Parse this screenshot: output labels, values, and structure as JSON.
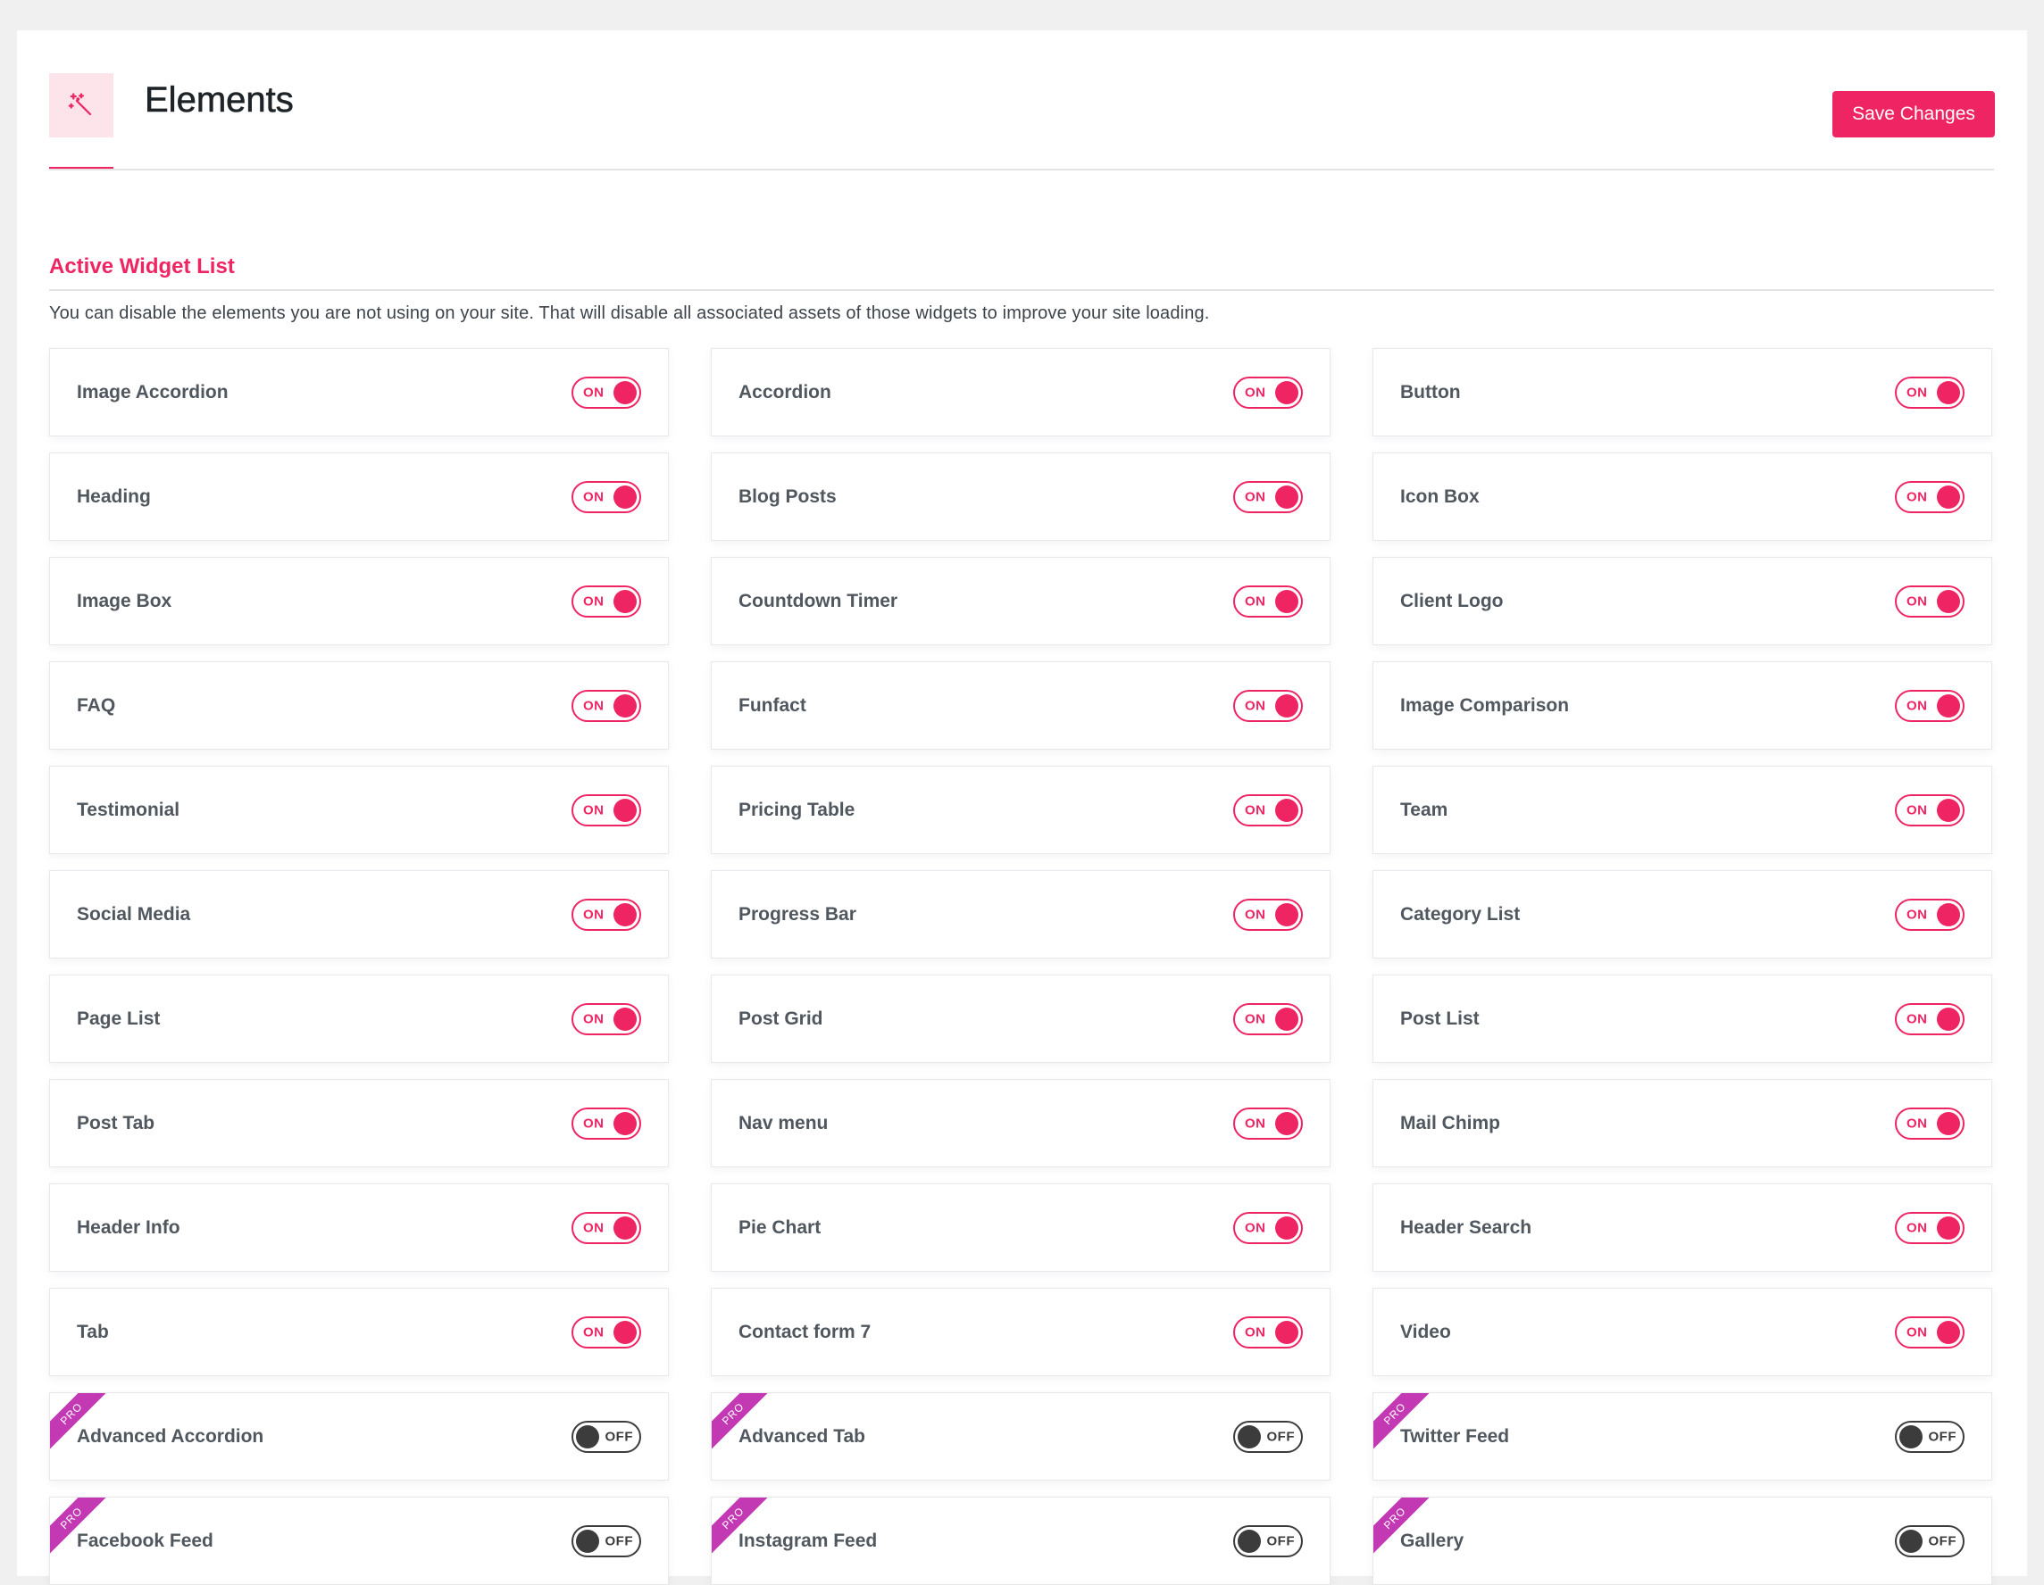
{
  "header": {
    "title": "Elements",
    "save_label": "Save Changes",
    "icon": "magic-wand-icon"
  },
  "section": {
    "title": "Active Widget List",
    "description": "You can disable the elements you are not using on your site. That will disable all associated assets of those widgets to improve your site loading."
  },
  "colors": {
    "accent": "#ef2563",
    "pro_ribbon": "#c239b3",
    "off": "#3c3c3c"
  },
  "widgets": [
    {
      "name": "Image Accordion",
      "state": "ON",
      "pro": false
    },
    {
      "name": "Accordion",
      "state": "ON",
      "pro": false
    },
    {
      "name": "Button",
      "state": "ON",
      "pro": false
    },
    {
      "name": "Heading",
      "state": "ON",
      "pro": false
    },
    {
      "name": "Blog Posts",
      "state": "ON",
      "pro": false
    },
    {
      "name": "Icon Box",
      "state": "ON",
      "pro": false
    },
    {
      "name": "Image Box",
      "state": "ON",
      "pro": false
    },
    {
      "name": "Countdown Timer",
      "state": "ON",
      "pro": false
    },
    {
      "name": "Client Logo",
      "state": "ON",
      "pro": false
    },
    {
      "name": "FAQ",
      "state": "ON",
      "pro": false
    },
    {
      "name": "Funfact",
      "state": "ON",
      "pro": false
    },
    {
      "name": "Image Comparison",
      "state": "ON",
      "pro": false
    },
    {
      "name": "Testimonial",
      "state": "ON",
      "pro": false
    },
    {
      "name": "Pricing Table",
      "state": "ON",
      "pro": false
    },
    {
      "name": "Team",
      "state": "ON",
      "pro": false
    },
    {
      "name": "Social Media",
      "state": "ON",
      "pro": false
    },
    {
      "name": "Progress Bar",
      "state": "ON",
      "pro": false
    },
    {
      "name": "Category List",
      "state": "ON",
      "pro": false
    },
    {
      "name": "Page List",
      "state": "ON",
      "pro": false
    },
    {
      "name": "Post Grid",
      "state": "ON",
      "pro": false
    },
    {
      "name": "Post List",
      "state": "ON",
      "pro": false
    },
    {
      "name": "Post Tab",
      "state": "ON",
      "pro": false
    },
    {
      "name": "Nav menu",
      "state": "ON",
      "pro": false
    },
    {
      "name": "Mail Chimp",
      "state": "ON",
      "pro": false
    },
    {
      "name": "Header Info",
      "state": "ON",
      "pro": false
    },
    {
      "name": "Pie Chart",
      "state": "ON",
      "pro": false
    },
    {
      "name": "Header Search",
      "state": "ON",
      "pro": false
    },
    {
      "name": "Tab",
      "state": "ON",
      "pro": false
    },
    {
      "name": "Contact form 7",
      "state": "ON",
      "pro": false
    },
    {
      "name": "Video",
      "state": "ON",
      "pro": false
    },
    {
      "name": "Advanced Accordion",
      "state": "OFF",
      "pro": true,
      "badge": "PRO"
    },
    {
      "name": "Advanced Tab",
      "state": "OFF",
      "pro": true,
      "badge": "PRO"
    },
    {
      "name": "Twitter Feed",
      "state": "OFF",
      "pro": true,
      "badge": "PRO"
    },
    {
      "name": "Facebook Feed",
      "state": "OFF",
      "pro": true,
      "badge": "PRO"
    },
    {
      "name": "Instagram Feed",
      "state": "OFF",
      "pro": true,
      "badge": "PRO"
    },
    {
      "name": "Gallery",
      "state": "OFF",
      "pro": true,
      "badge": "PRO"
    }
  ]
}
